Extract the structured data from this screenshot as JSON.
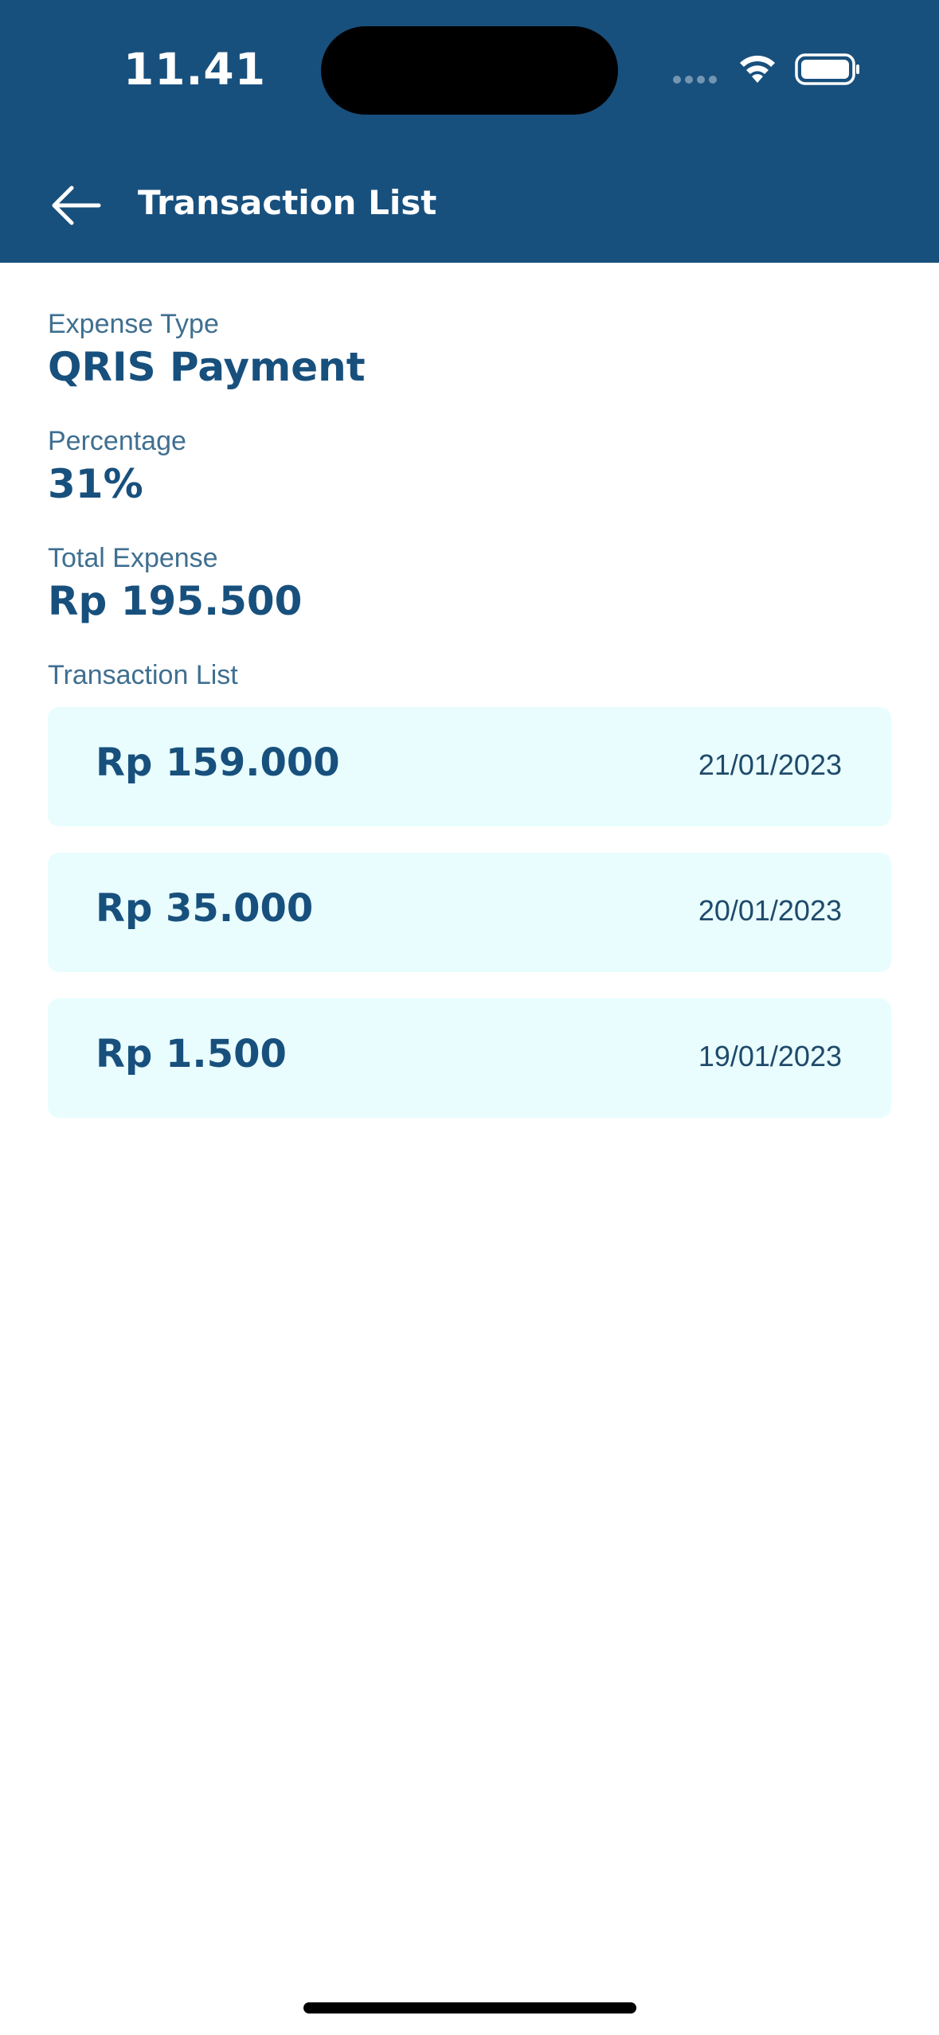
{
  "status_bar": {
    "time": "11.41",
    "icons": [
      "signal-dots-icon",
      "wifi-icon",
      "battery-icon"
    ]
  },
  "header": {
    "title": "Transaction List",
    "back_icon": "arrow-left-icon",
    "background_color": "#18507d"
  },
  "details": {
    "expense_type_label": "Expense Type",
    "expense_type_value": "QRIS Payment",
    "percentage_label": "Percentage",
    "percentage_value": "31%",
    "total_expense_label": "Total Expense",
    "total_expense_value": "Rp 195.500"
  },
  "transactions": {
    "section_label": "Transaction List",
    "items": [
      {
        "amount": "Rp 159.000",
        "date": "21/01/2023"
      },
      {
        "amount": "Rp 35.000",
        "date": "20/01/2023"
      },
      {
        "amount": "Rp 1.500",
        "date": "19/01/2023"
      }
    ]
  },
  "colors": {
    "primary": "#18507d",
    "label": "#3f6f90",
    "card_background": "#e9fdfe"
  }
}
